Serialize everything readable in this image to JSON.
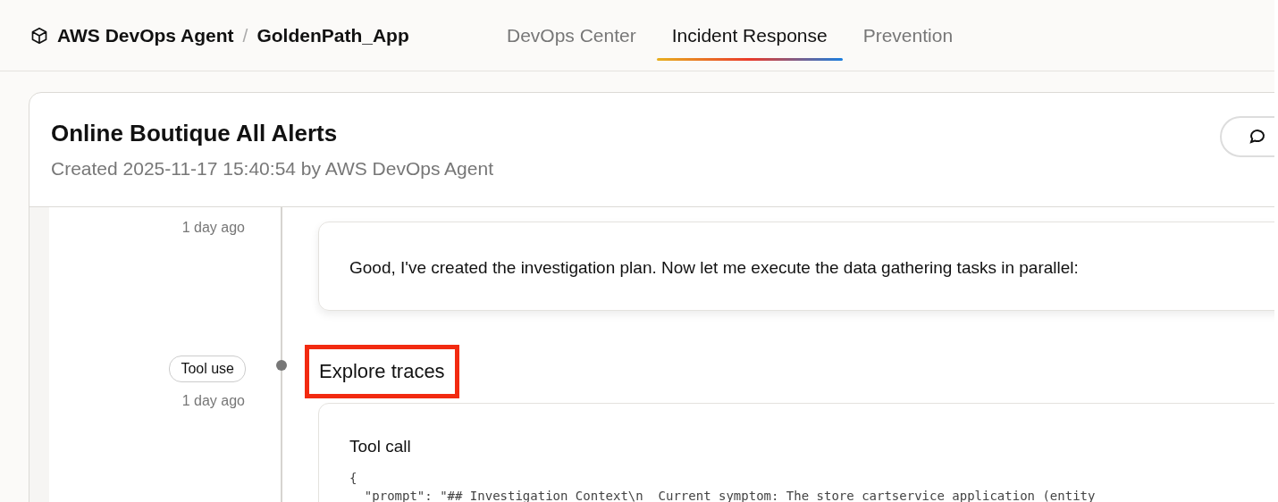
{
  "header": {
    "product": "AWS DevOps Agent",
    "separator": "/",
    "app": "GoldenPath_App"
  },
  "tabs": [
    {
      "label": "DevOps Center",
      "selected": false
    },
    {
      "label": "Incident Response",
      "selected": true
    },
    {
      "label": "Prevention",
      "selected": false
    }
  ],
  "incident": {
    "title": "Online Boutique All Alerts",
    "subtitle": "Created 2025-11-17 15:40:54 by AWS DevOps Agent"
  },
  "timeline": [
    {
      "kind": "message",
      "time": "1 day ago",
      "text": "Good, I've created the investigation plan. Now let me execute the data gathering tasks in parallel:"
    },
    {
      "kind": "tool",
      "badge": "Tool use",
      "time": "1 day ago",
      "heading": "Explore traces",
      "highlighted": true,
      "card_title": "Tool call",
      "code": [
        "{",
        "  \"prompt\": \"## Investigation Context\\n  Current symptom: The store cartservice application (entity"
      ]
    }
  ]
}
